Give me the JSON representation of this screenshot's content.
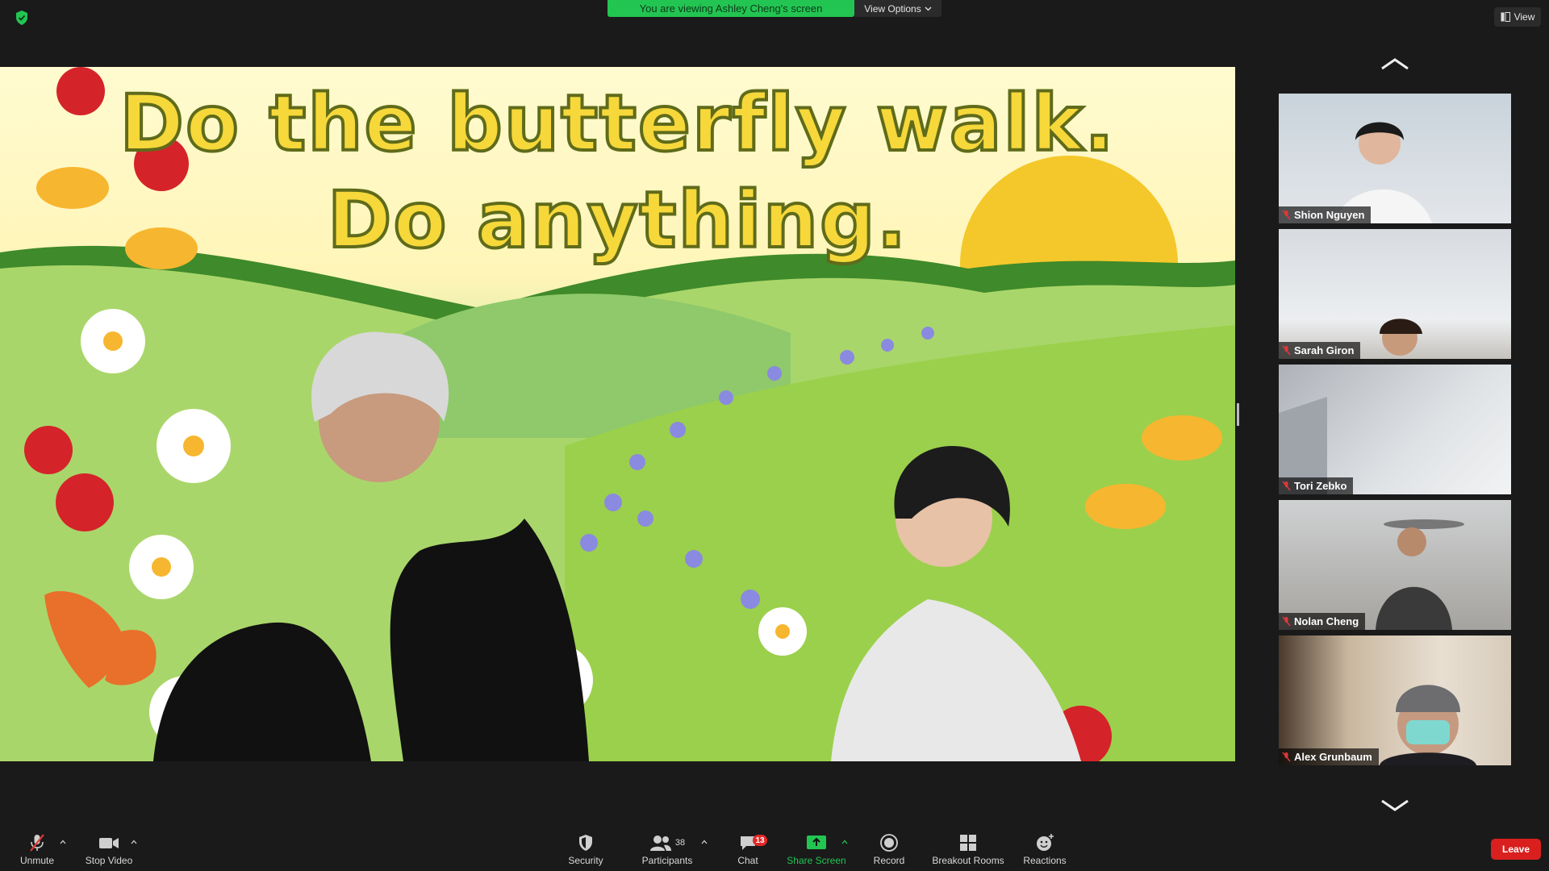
{
  "share": {
    "banner_text": "You are viewing Ashley Cheng's screen",
    "view_options_label": "View Options"
  },
  "view_button_label": "View",
  "stage": {
    "line1": "Do the butterfly walk.",
    "line2": "Do anything."
  },
  "participants_panel": [
    {
      "name": "Shion Nguyen"
    },
    {
      "name": "Sarah Giron"
    },
    {
      "name": "Tori Zebko"
    },
    {
      "name": "Nolan Cheng"
    },
    {
      "name": "Alex Grunbaum"
    }
  ],
  "toolbar": {
    "unmute_label": "Unmute",
    "stop_video_label": "Stop Video",
    "security_label": "Security",
    "participants_label": "Participants",
    "participants_count": "38",
    "chat_label": "Chat",
    "chat_badge": "13",
    "share_screen_label": "Share Screen",
    "record_label": "Record",
    "breakout_label": "Breakout Rooms",
    "reactions_label": "Reactions",
    "leave_label": "Leave"
  },
  "colors": {
    "share_green": "#23c552",
    "leave_red": "#d9201e",
    "badge_red": "#e02828",
    "toolbar_bg": "#1a1a1a"
  }
}
